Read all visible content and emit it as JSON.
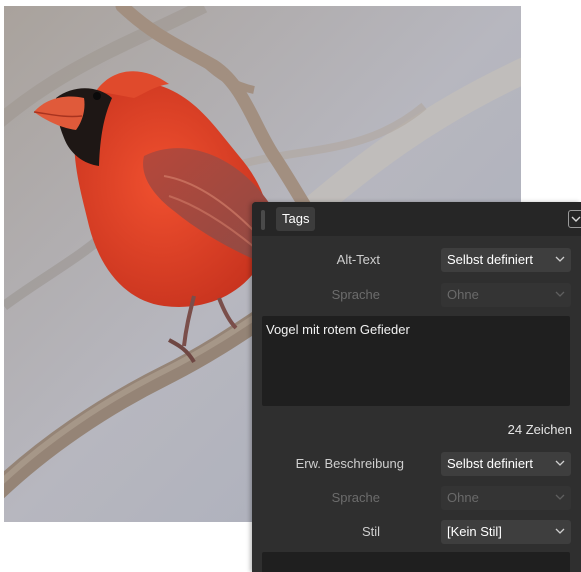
{
  "panel": {
    "tab_label": "Tags",
    "alt_text": {
      "label": "Alt-Text",
      "value": "Selbst definiert",
      "language_label": "Sprache",
      "language_value": "Ohne",
      "text": "Vogel mit rotem Gefieder",
      "counter": "24 Zeichen"
    },
    "ext_description": {
      "label": "Erw. Beschreibung",
      "value": "Selbst definiert",
      "language_label": "Sprache",
      "language_value": "Ohne"
    },
    "style": {
      "label": "Stil",
      "value": "[Kein Stil]"
    }
  },
  "colors": {
    "panel_bg": "#2f2f2f",
    "field_bg": "#1f1f1f",
    "bird_red": "#e0442a"
  },
  "icons": [
    "chevron-down-icon",
    "collapse-chevron-icon"
  ]
}
